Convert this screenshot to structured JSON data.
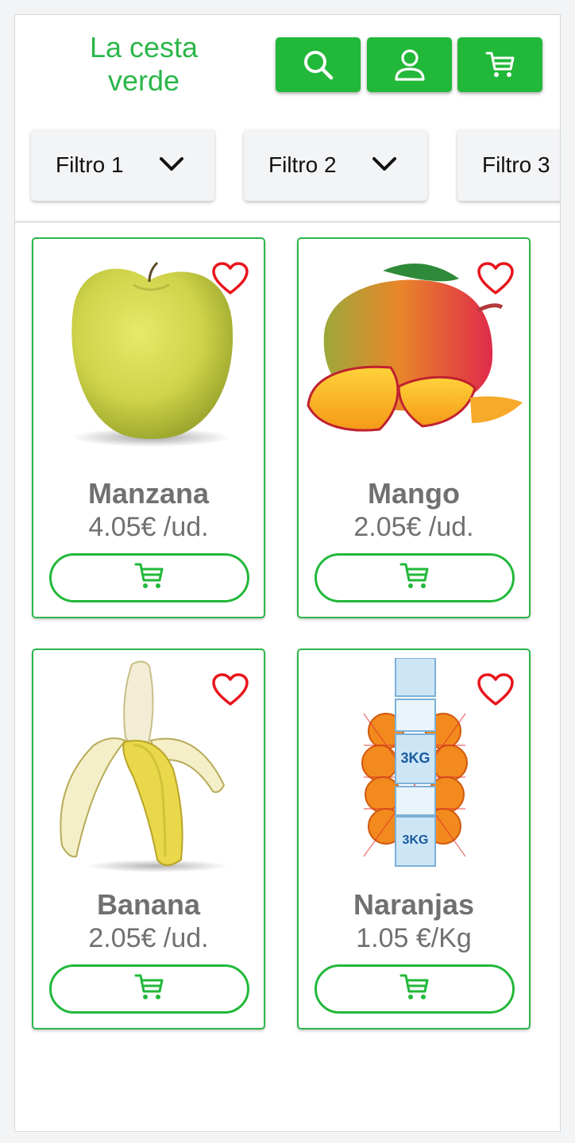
{
  "header": {
    "logo": "La cesta verde",
    "buttons": [
      {
        "icon": "search-icon"
      },
      {
        "icon": "user-icon"
      },
      {
        "icon": "cart-icon"
      }
    ]
  },
  "filters": [
    {
      "label": "Filtro 1"
    },
    {
      "label": "Filtro 2"
    },
    {
      "label": "Filtro 3"
    }
  ],
  "products": [
    {
      "name": "Manzana",
      "price": "4.05€ /ud.",
      "image": "apple"
    },
    {
      "name": "Mango",
      "price": "2.05€ /ud.",
      "image": "mango"
    },
    {
      "name": "Banana",
      "price": "2.05€ /ud.",
      "image": "banana"
    },
    {
      "name": "Naranjas",
      "price": "1.05 €/Kg",
      "image": "oranges-bag"
    }
  ],
  "colors": {
    "accent": "#22b83a",
    "logo": "#2cb64a",
    "heart": "#e8141c",
    "text_muted": "#707070"
  }
}
